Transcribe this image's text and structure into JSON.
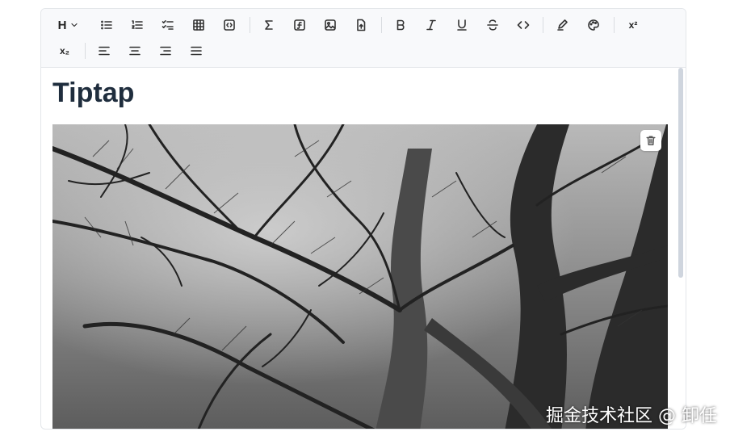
{
  "toolbar": {
    "heading_label": "H",
    "superscript_label": "x²",
    "subscript_label": "x₂"
  },
  "document": {
    "title": "Tiptap"
  },
  "watermark": "掘金技术社区 @ 卸任",
  "colors": {
    "title": "#1f2d3d",
    "toolbar_bg": "#f8f9fb",
    "scrollbar": "#cfd5de"
  }
}
